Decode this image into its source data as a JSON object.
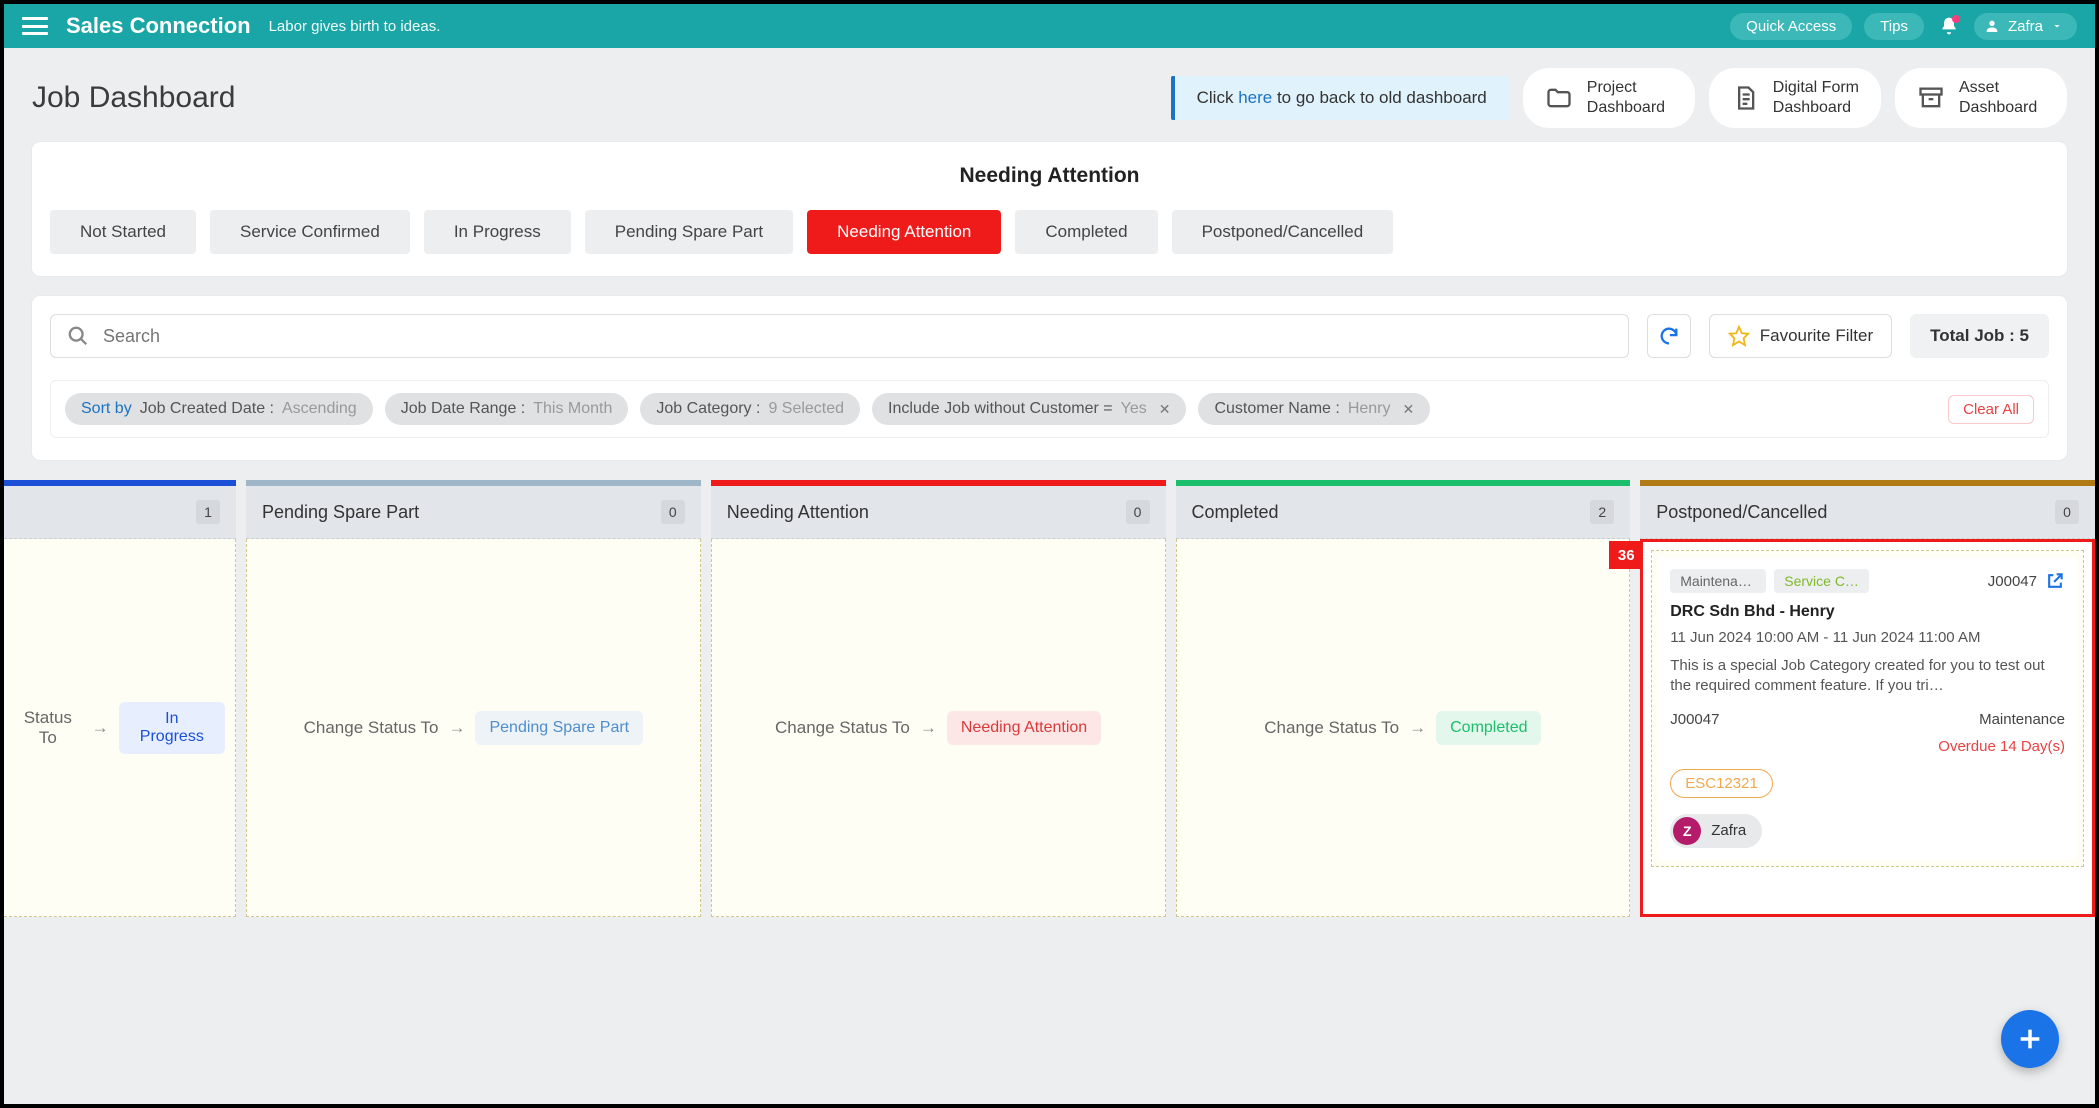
{
  "topbar": {
    "brand": "Sales Connection",
    "tagline": "Labor gives birth to ideas.",
    "quick_access": "Quick Access",
    "tips": "Tips",
    "user": "Zafra"
  },
  "header": {
    "title": "Job Dashboard",
    "old_dash_pre": "Click ",
    "old_dash_link": "here",
    "old_dash_post": " to go back to old dashboard",
    "nav": [
      {
        "line1": "Project",
        "line2": "Dashboard"
      },
      {
        "line1": "Digital Form",
        "line2": "Dashboard"
      },
      {
        "line1": "Asset",
        "line2": "Dashboard"
      }
    ]
  },
  "attention": {
    "title": "Needing Attention",
    "tabs": [
      "Not Started",
      "Service Confirmed",
      "In Progress",
      "Pending Spare Part",
      "Needing Attention",
      "Completed",
      "Postponed/Cancelled"
    ],
    "active_index": 4
  },
  "search": {
    "placeholder": "Search",
    "fav_filter": "Favourite Filter",
    "total_label": "Total Job : ",
    "total_value": "5"
  },
  "filters": {
    "sortby_label": "Sort by",
    "sortby_field": "Job Created Date : ",
    "sortby_order": "Ascending",
    "date_range_label": "Job Date Range : ",
    "date_range_value": "This Month",
    "category_label": "Job Category : ",
    "category_value": "9 Selected",
    "include_label": "Include Job without Customer = ",
    "include_value": "Yes",
    "customer_label": "Customer Name : ",
    "customer_value": "Henry",
    "clear_all": "Clear All"
  },
  "board": {
    "change_text": "Change Status To",
    "first_status_text": "Status To",
    "columns": [
      {
        "name": "",
        "count": "1",
        "top_color": "#1b4fd6",
        "status_label": "In Progress",
        "status_bg": "#e7efff",
        "status_color": "#1b4fd6"
      },
      {
        "name": "Pending Spare Part",
        "count": "0",
        "top_color": "#9fb6c9",
        "status_label": "Pending Spare Part",
        "status_bg": "#eef3f7",
        "status_color": "#4f8ecb"
      },
      {
        "name": "Needing Attention",
        "count": "0",
        "top_color": "#ef1b1b",
        "status_label": "Needing Attention",
        "status_bg": "#fde6e6",
        "status_color": "#d93a3a"
      },
      {
        "name": "Completed",
        "count": "2",
        "top_color": "#1bbf6b",
        "status_label": "Completed",
        "status_bg": "#e3f7ec",
        "status_color": "#1bbf6b"
      },
      {
        "name": "Postponed/Cancelled",
        "count": "0",
        "top_color": "#b07b15"
      }
    ],
    "highlight_flag": "36"
  },
  "job": {
    "tag1": "Maintenan…",
    "tag2": "Service C…",
    "id_top": "J00047",
    "title": "DRC Sdn Bhd - Henry",
    "time": "11 Jun 2024 10:00 AM - 11 Jun 2024 11:00 AM",
    "desc": "This is a special Job Category created for you to test out the required comment feature. If you tri…",
    "id_bottom": "J00047",
    "type": "Maintenance",
    "overdue": "Overdue 14 Day(s)",
    "esc": "ESC12321",
    "assignee_initial": "Z",
    "assignee": "Zafra"
  }
}
